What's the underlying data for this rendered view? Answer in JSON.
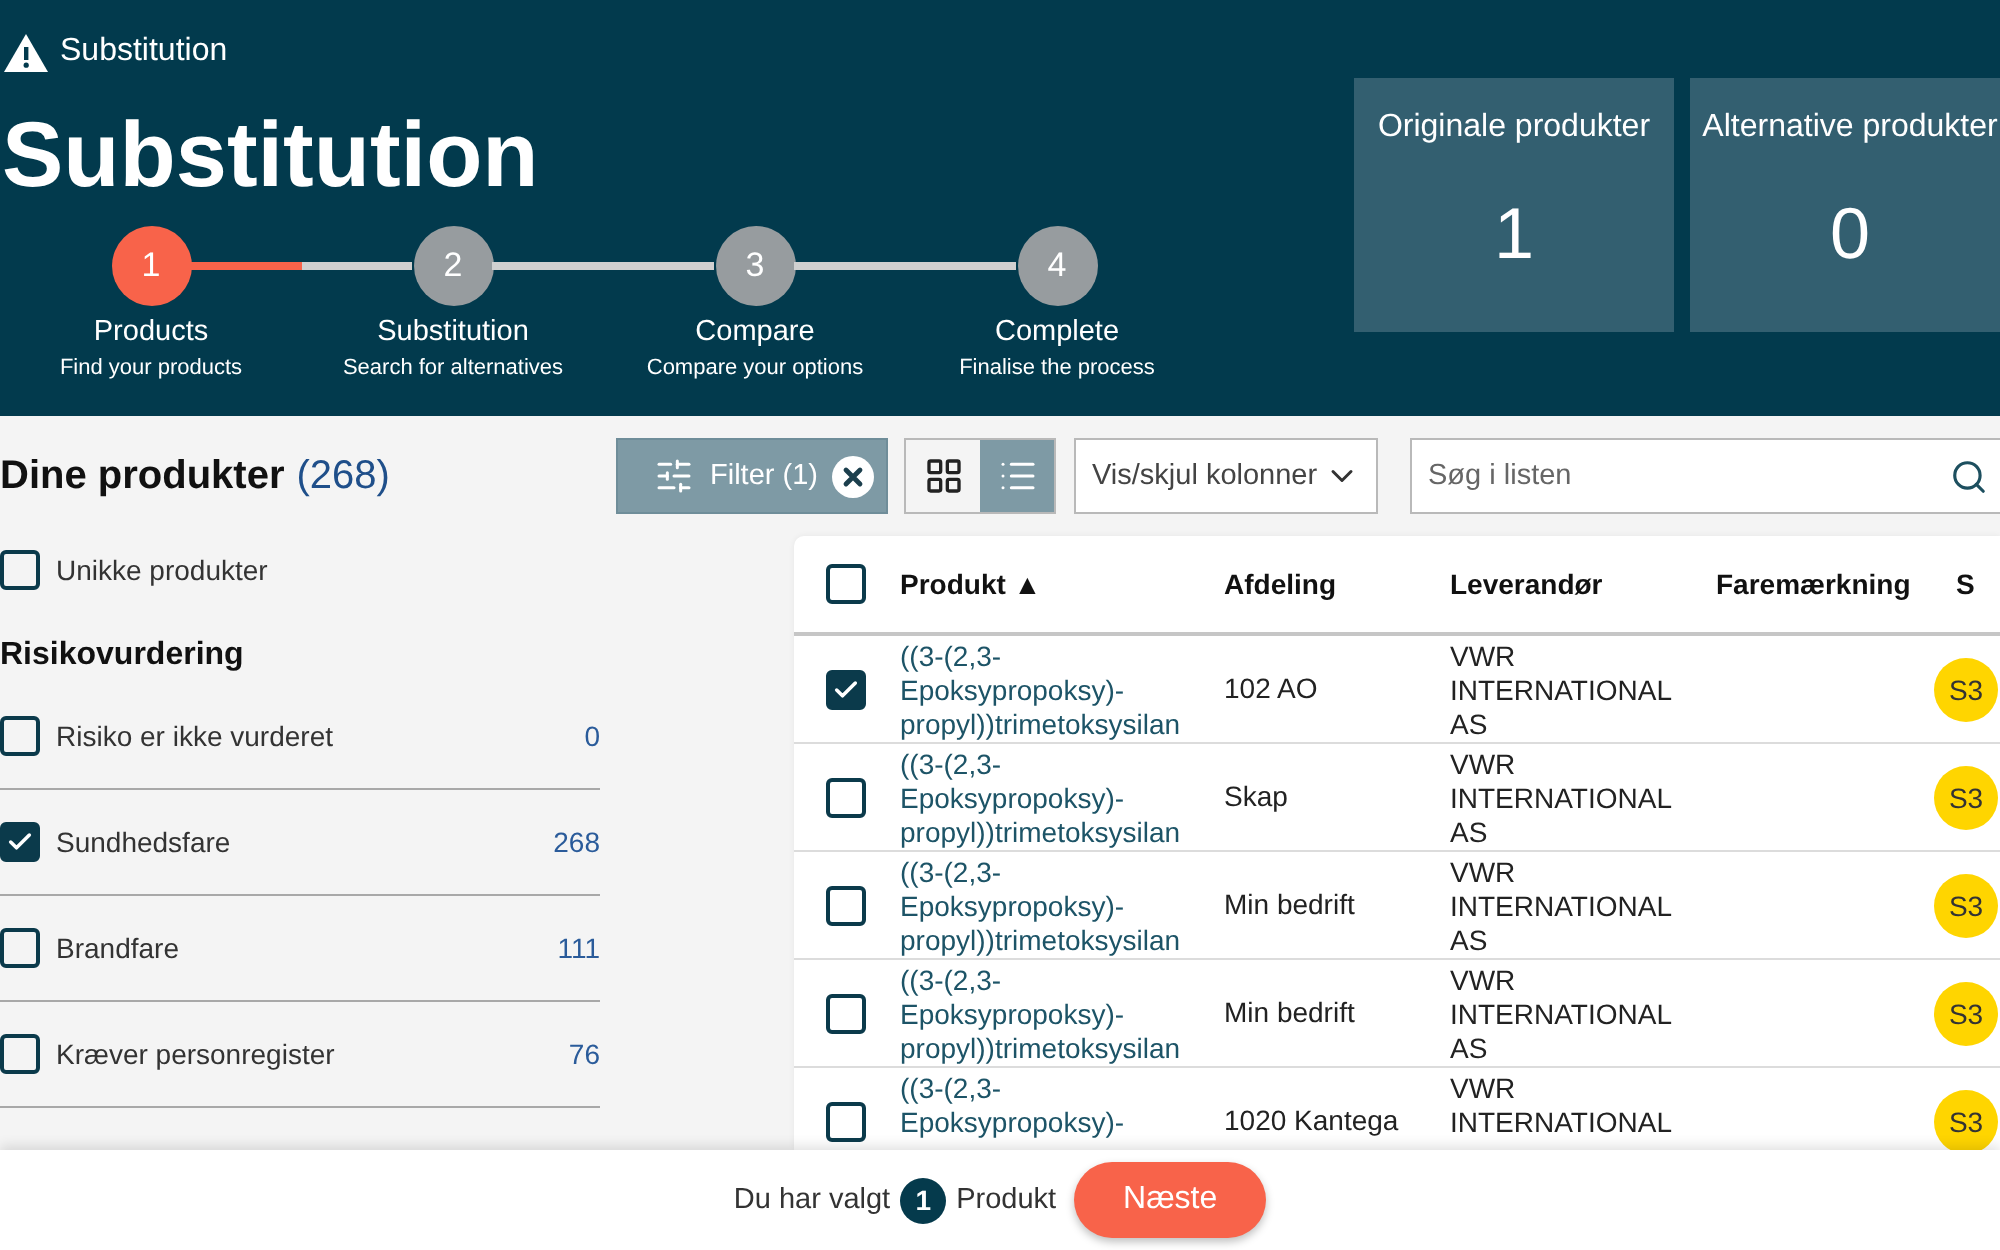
{
  "header": {
    "breadcrumb": "Substitution",
    "title": "Substitution"
  },
  "stepper": {
    "steps": [
      {
        "number": "1",
        "label": "Products",
        "description": "Find your products",
        "selected": true,
        "level": 0.5
      },
      {
        "number": "2",
        "label": "Substitution",
        "description": "Search for alternatives",
        "selected": false
      },
      {
        "number": "3",
        "label": "Compare",
        "description": "Compare your options",
        "selected": false
      },
      {
        "number": "4",
        "label": "Complete",
        "description": "Finalise the process",
        "selected": false
      }
    ]
  },
  "stats": [
    {
      "label": "Originale produkter",
      "value": "1"
    },
    {
      "label": "Alternative produkter",
      "value": "0"
    }
  ],
  "sidebar": {
    "title": "Dine produkter",
    "count": "(268)",
    "unique_filter": {
      "label": "Unikke produkter",
      "checked": false
    },
    "section_title": "Risikovurdering",
    "filters": [
      {
        "label": "Risiko er ikke vurderet",
        "count": "0",
        "checked": false
      },
      {
        "label": "Sundhedsfare",
        "count": "268",
        "checked": true
      },
      {
        "label": "Brandfare",
        "count": "111",
        "checked": false
      },
      {
        "label": "Kræver personregister",
        "count": "76",
        "checked": false
      }
    ]
  },
  "toolbar": {
    "filter_button": "Filter (1)",
    "view_modes": [
      {
        "kind": "grid",
        "selected": false
      },
      {
        "kind": "list",
        "selected": true
      }
    ],
    "columns_dropdown": "Vis/skjul kolonner",
    "search": {
      "placeholder": "Søg i listen"
    }
  },
  "table": {
    "all_checked": false,
    "columns": [
      {
        "label": "Produkt ▲"
      },
      {
        "label": "Afdeling"
      },
      {
        "label": "Leverandør"
      },
      {
        "label": "Faremærkning"
      },
      {
        "label": "S"
      }
    ],
    "rows": [
      {
        "checked": true,
        "product": "((3-(2,3-Epoksypropoksy)-propyl))trimetoksysilan",
        "department": "102 AO",
        "supplier": "VWR INTERNATIONAL AS",
        "badge": "S3"
      },
      {
        "checked": false,
        "product": "((3-(2,3-Epoksypropoksy)-propyl))trimetoksysilan",
        "department": "Skap",
        "supplier": "VWR INTERNATIONAL AS",
        "badge": "S3"
      },
      {
        "checked": false,
        "product": "((3-(2,3-Epoksypropoksy)-propyl))trimetoksysilan",
        "department": "Min bedrift",
        "supplier": "VWR INTERNATIONAL AS",
        "badge": "S3"
      },
      {
        "checked": false,
        "product": "((3-(2,3-Epoksypropoksy)-propyl))trimetoksysilan",
        "department": "Min bedrift",
        "supplier": "VWR INTERNATIONAL AS",
        "badge": "S3"
      },
      {
        "checked": false,
        "product": "((3-(2,3-Epoksypropoksy)-",
        "department": "1020 Kantega",
        "supplier": "VWR INTERNATIONAL",
        "badge": "S3"
      }
    ]
  },
  "footer": {
    "prefix": "Du har valgt",
    "count": "1",
    "suffix": "Produkt",
    "next_button": "Næste"
  }
}
